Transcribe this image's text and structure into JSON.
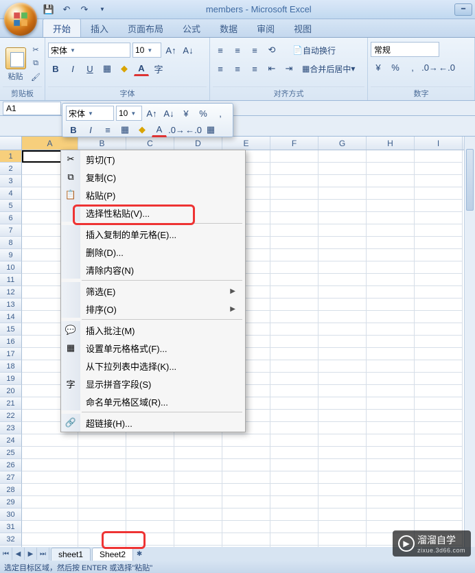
{
  "title": "members - Microsoft Excel",
  "tabs": [
    "开始",
    "插入",
    "页面布局",
    "公式",
    "数据",
    "审阅",
    "视图"
  ],
  "active_tab": 0,
  "ribbon": {
    "clipboard_label": "剪贴板",
    "paste_label": "粘贴",
    "font_label": "字体",
    "align_label": "对齐方式",
    "number_label": "数字",
    "font_name": "宋体",
    "font_size": "10",
    "wrap_text": "自动换行",
    "merge_center": "合并后居中",
    "number_format": "常规"
  },
  "mini_toolbar": {
    "font_name": "宋体",
    "font_size": "10"
  },
  "namebox": "A1",
  "columns": [
    "A",
    "B",
    "C",
    "D",
    "E",
    "F",
    "G",
    "H",
    "I"
  ],
  "row_count": 34,
  "context_menu": [
    {
      "icon": "cut",
      "label": "剪切(T)"
    },
    {
      "icon": "copy",
      "label": "复制(C)"
    },
    {
      "icon": "paste",
      "label": "粘贴(P)"
    },
    {
      "icon": "",
      "label": "选择性粘贴(V)...",
      "highlight": true
    },
    {
      "sep": true
    },
    {
      "icon": "",
      "label": "插入复制的单元格(E)..."
    },
    {
      "icon": "",
      "label": "删除(D)..."
    },
    {
      "icon": "",
      "label": "清除内容(N)"
    },
    {
      "sep": true
    },
    {
      "icon": "",
      "label": "筛选(E)",
      "sub": true
    },
    {
      "icon": "",
      "label": "排序(O)",
      "sub": true
    },
    {
      "sep": true
    },
    {
      "icon": "comment",
      "label": "插入批注(M)"
    },
    {
      "icon": "format",
      "label": "设置单元格格式(F)..."
    },
    {
      "icon": "",
      "label": "从下拉列表中选择(K)..."
    },
    {
      "icon": "pinyin",
      "label": "显示拼音字段(S)"
    },
    {
      "icon": "",
      "label": "命名单元格区域(R)..."
    },
    {
      "sep": true
    },
    {
      "icon": "link",
      "label": "超链接(H)..."
    }
  ],
  "sheets": {
    "list": [
      "sheet1",
      "Sheet2"
    ],
    "active": 1
  },
  "status": "选定目标区域，然后按 ENTER 或选择\"粘贴\"",
  "watermark": {
    "brand": "溜溜自学",
    "url": "zixue.3d66.com"
  }
}
